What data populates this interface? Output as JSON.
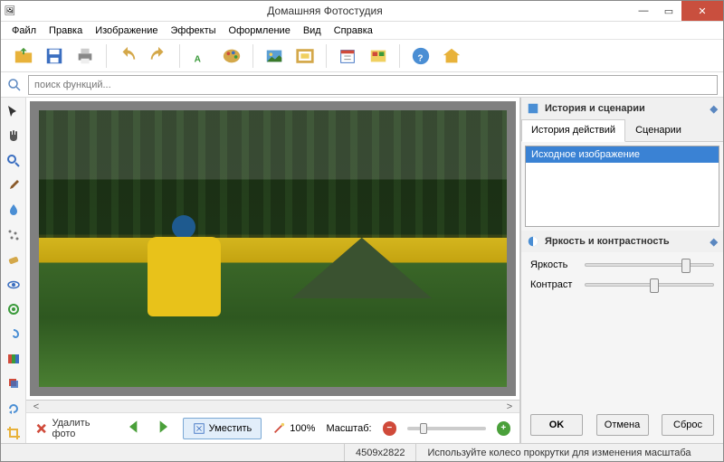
{
  "window": {
    "title": "Домашняя Фотостудия"
  },
  "menu": {
    "file": "Файл",
    "edit": "Правка",
    "image": "Изображение",
    "effects": "Эффекты",
    "decoration": "Оформление",
    "view": "Вид",
    "help": "Справка"
  },
  "search": {
    "placeholder": "поиск функций..."
  },
  "bottombar": {
    "delete_photo": "Удалить фото",
    "fit": "Уместить",
    "zoom_100": "100%",
    "scale_label": "Масштаб:"
  },
  "sidebar": {
    "history_panel_title": "История и сценарии",
    "tab_history": "История действий",
    "tab_scenarios": "Сценарии",
    "history_items": [
      "Исходное изображение"
    ],
    "bc_panel_title": "Яркость и контрастность",
    "brightness_label": "Яркость",
    "contrast_label": "Контраст",
    "ok": "OK",
    "cancel": "Отмена",
    "reset": "Сброс"
  },
  "statusbar": {
    "dimensions": "4509x2822",
    "hint": "Используйте колесо прокрутки для изменения масштаба"
  }
}
